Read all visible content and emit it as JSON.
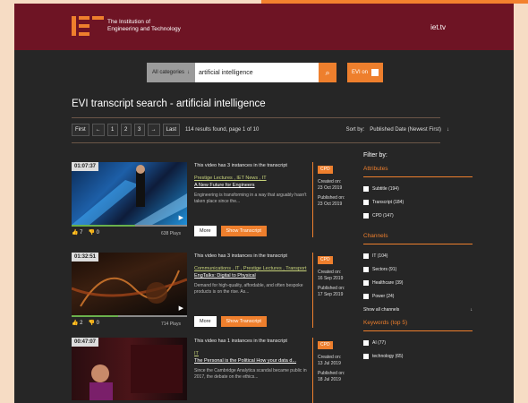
{
  "header": {
    "org_line1": "The Institution of",
    "org_line2": "Engineering and Technology",
    "site": "iet.tv"
  },
  "search": {
    "category_label": "All categories",
    "category_icon": "arrow-down-icon",
    "query": "artificial intelligence",
    "button_icon": "search-icon",
    "evi_label": "EVI on"
  },
  "page": {
    "title": "EVI transcript search - artificial intelligence",
    "pager": {
      "first": "First",
      "prev": "←",
      "pages": [
        "1",
        "2",
        "3"
      ],
      "next": "→",
      "last": "Last",
      "count": "114 results found, page 1 of 10"
    },
    "sort_label": "Sort by:",
    "sort_value": "Published Date (Newest First)",
    "sort_icon": "↓"
  },
  "results": [
    {
      "duration": "01:07:37",
      "instances": "This video has 3 instances in the transcript",
      "tags": "Prestige Lectures , IET News , IT",
      "title": "A New Future for Engineers",
      "snippet": "Engineering is transforming in a way that arguably hasn't taken place since the...",
      "likes": "7",
      "dislikes": "0",
      "plays": "638 Plays",
      "more": "More",
      "show": "Show Transcript",
      "badge": "CPD",
      "created_label": "Created on:",
      "created": "23 Oct 2019",
      "published_label": "Published on:",
      "published": "23 Oct 2019",
      "progress": 0.55
    },
    {
      "duration": "01:32:51",
      "instances": "This video has 3 instances in the transcript",
      "tags": "Communications , IT , Prestige Lectures , Transport",
      "title": "EngTalks: Digital to Physical",
      "snippet": "Demand for high-quality, affordable, and often bespoke products is on the rise. As...",
      "likes": "2",
      "dislikes": "0",
      "plays": "714 Plays",
      "more": "More",
      "show": "Show Transcript",
      "badge": "CPD",
      "created_label": "Created on:",
      "created": "16 Sep 2019",
      "published_label": "Published on:",
      "published": "17 Sep 2019",
      "progress": 0.4
    },
    {
      "duration": "00:47:07",
      "instances": "This video has 1 instances in the transcript",
      "tags": "IT",
      "title": "The Personal is the Political How your data d...",
      "snippet": "Since the Cambridge Analytica scandal became public in 2017, the debate on the ethics...",
      "badge": "CPD",
      "created_label": "Created on:",
      "created": "13 Jul 2019",
      "published_label": "Published on:",
      "published": "18 Jul 2019"
    }
  ],
  "filters": {
    "heading": "Filter by:",
    "attributes_label": "Attributes",
    "attributes": [
      "Subtitle (194)",
      "Transcript (184)",
      "CPD (147)"
    ],
    "channels_label": "Channels",
    "channels": [
      "IT (104)",
      "Sectors (91)",
      "Healthcare (39)",
      "Power (24)"
    ],
    "show_all": "Show all channels",
    "show_all_icon": "↓",
    "keywords_label": "Keywords (top 5)",
    "keywords": [
      "AI (77)",
      "technology (65)"
    ]
  },
  "colors": {
    "brand": "#6e1424",
    "accent": "#ee7f2d",
    "background": "#262626"
  }
}
